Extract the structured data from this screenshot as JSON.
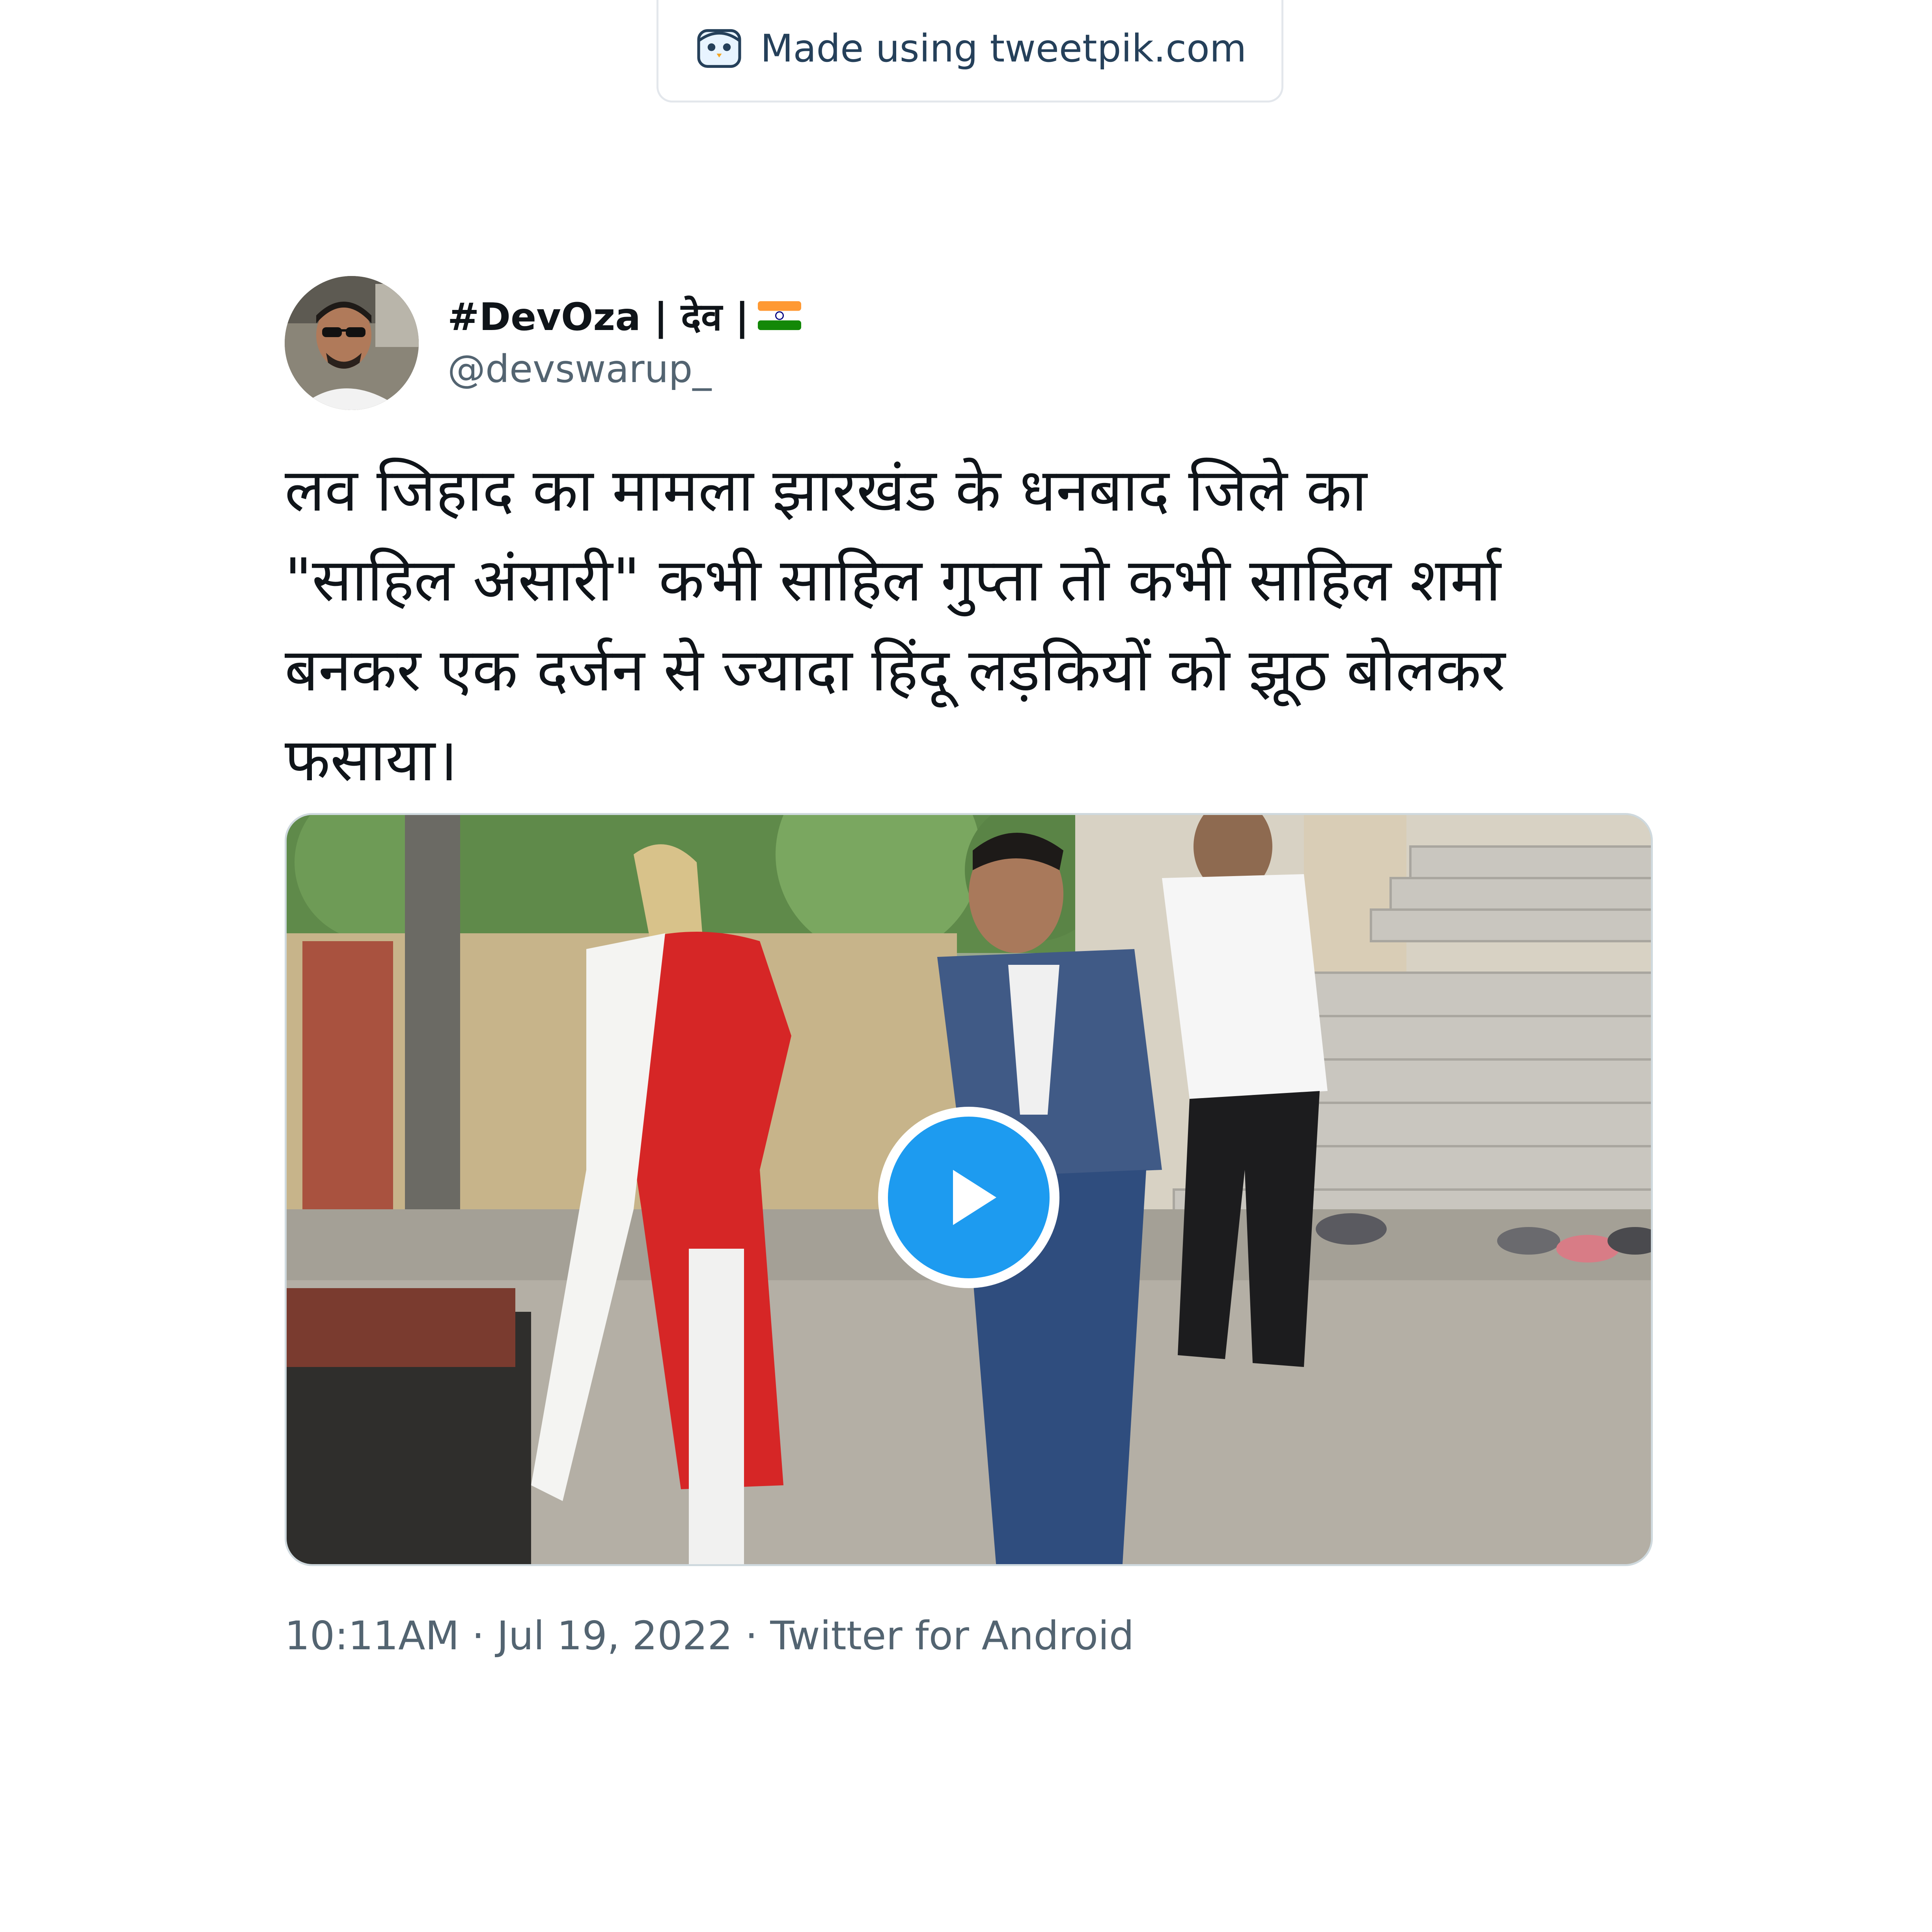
{
  "watermark": {
    "text": "Made using tweetpik.com",
    "icon": "tweetpik-bird-icon"
  },
  "tweet": {
    "author": {
      "display_name": "#DevOza | देव |",
      "flag_icon": "india-flag-icon",
      "handle": "@devswarup_",
      "avatar_icon": "user-avatar"
    },
    "text": "लव जिहाद का मामला झारखंड के धनबाद जिले का\n\"साहिल अंसारी\" कभी साहिल गुप्ता तो कभी साहिल शर्मा\nबनकर एक दर्जन से ज्यादा हिंदू लड़कियों को झूठ बोलकर\nफसाया।",
    "media": {
      "type": "video",
      "play_icon": "play-icon"
    },
    "meta": {
      "time": "10:11AM",
      "date": "Jul 19, 2022",
      "source": "Twitter for Android",
      "separator": "·"
    }
  },
  "colors": {
    "text_primary": "#0f1419",
    "text_secondary": "#536471",
    "accent": "#1d9bf0",
    "border": "#cfd9de"
  }
}
